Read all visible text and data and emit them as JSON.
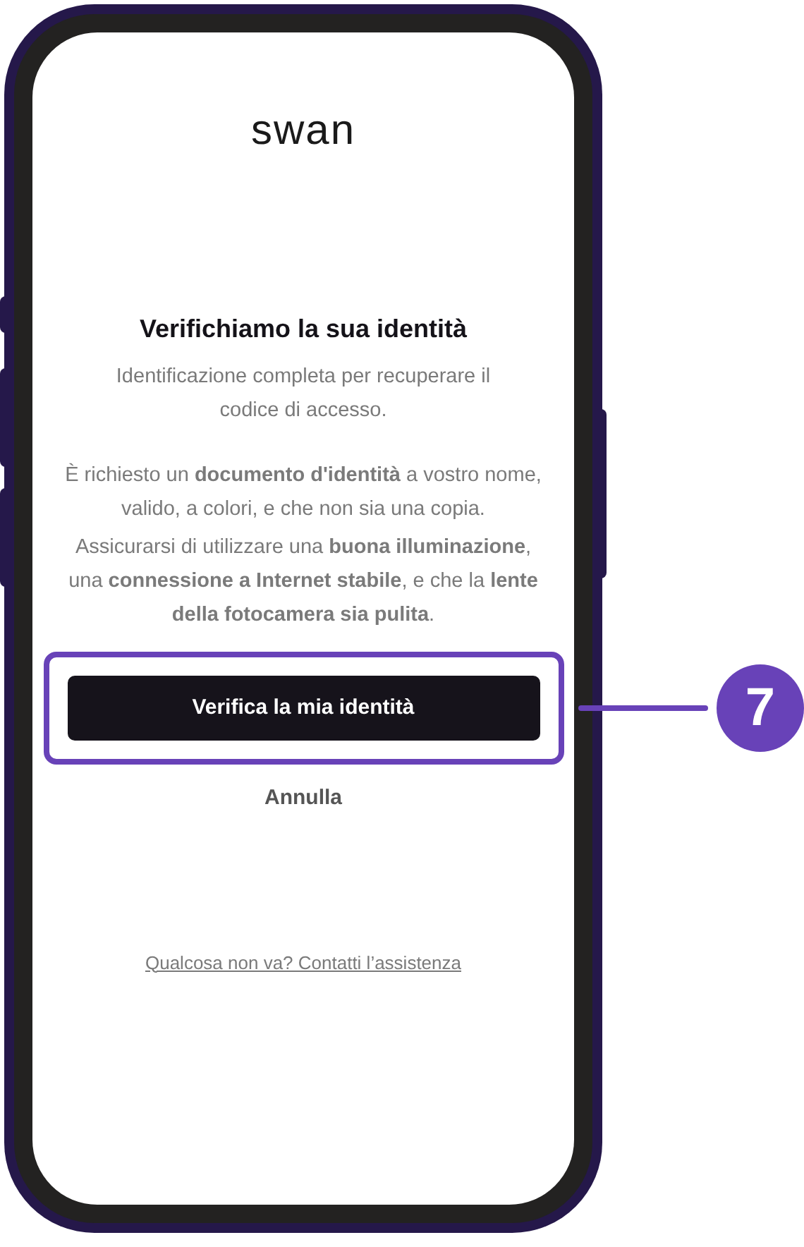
{
  "logo": "swan",
  "title": "Verifichiamo la sua identità",
  "subtitle": "Identificazione completa per recuperare il codice di accesso.",
  "paragraphs": [
    "È richiesto un **documento d'identità** a vostro nome, valido, a colori, e che non sia una copia.",
    "Assicurarsi di utilizzare una **buona illuminazione**, una **connessione a Internet stabile**, e che la **lente della fotocamera sia pulita**."
  ],
  "primary_button": {
    "label": "Verifica la mia identità",
    "highlighted": true
  },
  "callout": {
    "number": "7"
  },
  "cancel": "Annulla",
  "support_link": "Qualcosa non va? Contatti l’assistenza"
}
